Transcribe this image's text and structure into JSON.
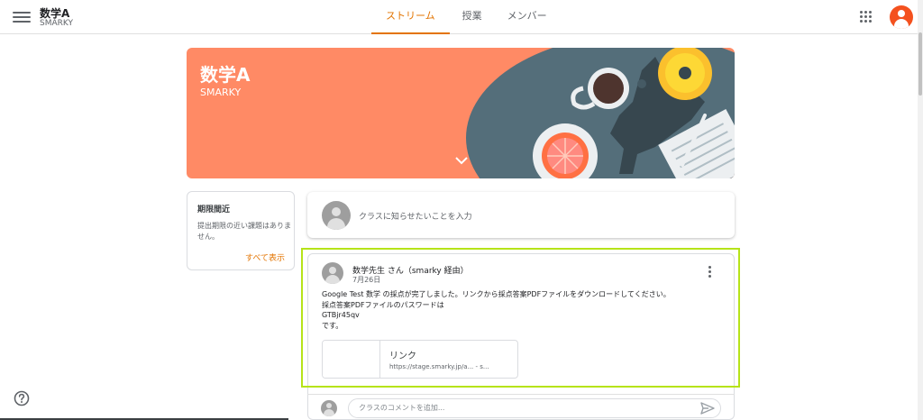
{
  "topbar": {
    "class_title": "数学A",
    "class_section": "SMARKY",
    "tabs": [
      {
        "label": "ストリーム",
        "active": true
      },
      {
        "label": "授業",
        "active": false
      },
      {
        "label": "メンバー",
        "active": false
      }
    ],
    "icons": [
      "hamburger-menu-icon",
      "apps-grid-icon",
      "user-avatar"
    ]
  },
  "banner": {
    "title": "数学A",
    "subtitle": "SMARKY",
    "color": "#ff8a65"
  },
  "upcoming": {
    "title": "期限間近",
    "body": "提出期限の近い課題はありません。",
    "view_all": "すべて表示"
  },
  "announce": {
    "placeholder": "クラスに知らせたいことを入力"
  },
  "post": {
    "author": "数学先生 さん（smarky 経由）",
    "date": "7月26日",
    "lines": [
      "Google Test 数学 の採点が完了しました。リンクから採点答案PDFファイルをダウンロードしてください。",
      "採点答案PDFファイルのパスワードは",
      "GTBjr45qv",
      "です。"
    ],
    "link": {
      "title": "リンク",
      "url": "https://stage.smarky.jp/a... - s..."
    },
    "highlight_color": "#b6e319"
  },
  "comment": {
    "placeholder": "クラスのコメントを追加..."
  },
  "colors": {
    "accent": "#e37400",
    "banner": "#ff8a65"
  }
}
